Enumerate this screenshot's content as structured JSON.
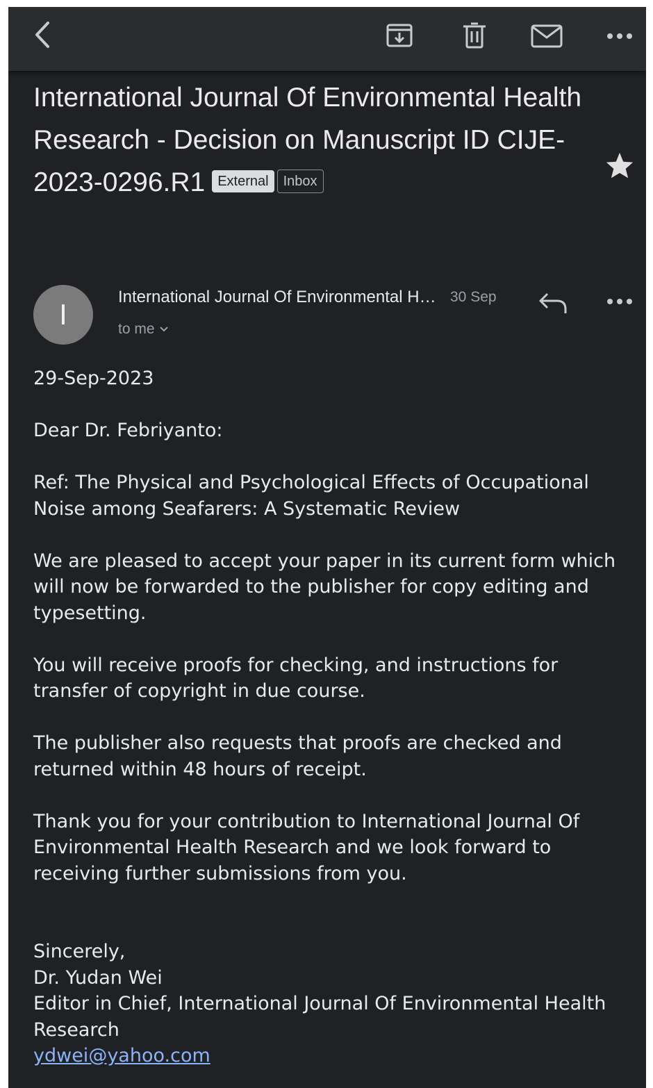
{
  "toolbar": {
    "back_icon": "back-arrow-icon",
    "archive_icon": "archive-icon",
    "delete_icon": "trash-icon",
    "mark_unread_icon": "mail-icon",
    "more_icon": "more-horizontal-icon"
  },
  "email": {
    "subject": "International Journal Of Environmental Health Research - Decision on Manuscript ID CIJE-2023-0296.R1",
    "labels": [
      "External",
      "Inbox"
    ],
    "starred": true,
    "sender_initial": "I",
    "sender_name": "International Journal Of Environmental Health Research",
    "date": "30 Sep",
    "recipient": "to me",
    "body": {
      "date_line": "29-Sep-2023",
      "salutation": "Dear Dr. Febriyanto:",
      "ref": "Ref: The Physical and Psychological Effects of Occupational Noise among Seafarers: A Systematic Review",
      "para1": "We are pleased to accept your paper in its current form which will now be forwarded to the publisher for copy editing and typesetting.",
      "para2": "You will receive proofs for checking, and instructions for transfer of copyright in due course.",
      "para3": "The publisher also requests that proofs are checked and returned within 48 hours of receipt.",
      "para4": "Thank you for your contribution to International Journal Of Environmental Health Research and we look forward to receiving further submissions from you.",
      "closing": "Sincerely,",
      "signer": "Dr. Yudan Wei",
      "signer_title": "Editor in Chief, International Journal Of Environmental Health Research",
      "signer_email": "ydwei@yahoo.com"
    }
  }
}
